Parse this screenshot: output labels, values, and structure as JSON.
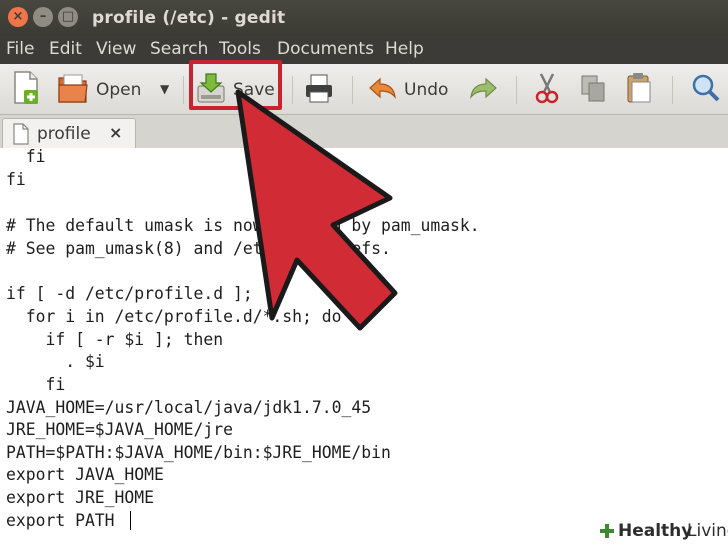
{
  "window": {
    "title": "profile (/etc) - gedit",
    "controls": {
      "close": "×",
      "minimize": "–",
      "maximize": "□"
    }
  },
  "menu": [
    "File",
    "Edit",
    "View",
    "Search",
    "Tools",
    "Documents",
    "Help"
  ],
  "toolbar": {
    "open_label": "Open",
    "save_label": "Save",
    "undo_label": "Undo"
  },
  "tab": {
    "label": "profile",
    "close": "×"
  },
  "editor": {
    "lines": [
      "  fi",
      "fi",
      "",
      "# The default umask is now handled by pam_umask.",
      "# See pam_umask(8) and /etc/login.defs.",
      "",
      "if [ -d /etc/profile.d ];",
      "  for i in /etc/profile.d/*.sh; do",
      "    if [ -r $i ]; then",
      "      . $i",
      "    fi",
      "JAVA_HOME=/usr/local/java/jdk1.7.0_45",
      "JRE_HOME=$JAVA_HOME/jre",
      "PATH=$PATH:$JAVA_HOME/bin:$JRE_HOME/bin",
      "export JAVA_HOME",
      "export JRE_HOME",
      "export PATH"
    ]
  },
  "watermark": {
    "healthy": "Healthy",
    "living": "Living"
  },
  "colors": {
    "highlight": "#c8242f",
    "arrow": "#d12b36"
  }
}
